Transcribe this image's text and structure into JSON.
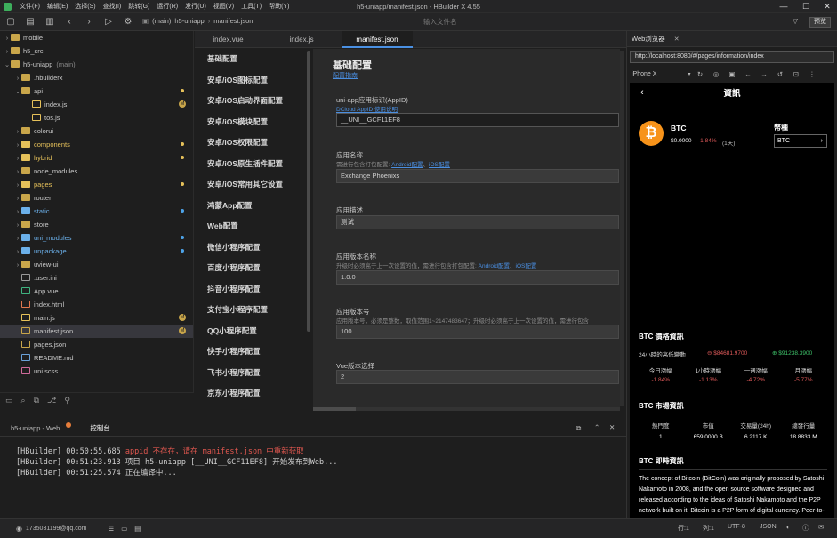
{
  "menu": [
    "文件(F)",
    "编辑(E)",
    "选择(S)",
    "查找(I)",
    "跳转(G)",
    "运行(R)",
    "发行(U)",
    "视图(V)",
    "工具(T)",
    "帮助(Y)"
  ],
  "window_title": "h5-uniapp/manifest.json - HBuilder X 4.55",
  "breadcrumb": [
    "(main)",
    "h5-uniapp",
    "manifest.json"
  ],
  "file_search_placeholder": "输入文件名",
  "preview_button": "预览",
  "tree": [
    {
      "name": "mobile",
      "depth": 0,
      "type": "folder",
      "arrow": "›"
    },
    {
      "name": "h5_src",
      "depth": 0,
      "type": "folder",
      "arrow": "›"
    },
    {
      "name": "h5-uniapp",
      "depth": 0,
      "type": "folder",
      "arrow": "⌄",
      "suffix": "(main)"
    },
    {
      "name": ".hbuilderx",
      "depth": 1,
      "type": "folder",
      "arrow": "›"
    },
    {
      "name": "api",
      "depth": 1,
      "type": "folder",
      "arrow": "⌄",
      "dot": "#e6c15a"
    },
    {
      "name": "index.js",
      "depth": 2,
      "type": "js",
      "badge": "M"
    },
    {
      "name": "tos.js",
      "depth": 2,
      "type": "js"
    },
    {
      "name": "colorui",
      "depth": 1,
      "type": "folder",
      "arrow": "›"
    },
    {
      "name": "components",
      "depth": 1,
      "type": "folder",
      "arrow": "›",
      "dot": "#e6c15a",
      "color": "#e6c15a"
    },
    {
      "name": "hybrid",
      "depth": 1,
      "type": "folder",
      "arrow": "›",
      "dot": "#e6c15a",
      "color": "#e6c15a"
    },
    {
      "name": "node_modules",
      "depth": 1,
      "type": "folder",
      "arrow": "›"
    },
    {
      "name": "pages",
      "depth": 1,
      "type": "folder",
      "arrow": "›",
      "dot": "#e6c15a",
      "color": "#e6c15a"
    },
    {
      "name": "router",
      "depth": 1,
      "type": "folder",
      "arrow": "›"
    },
    {
      "name": "static",
      "depth": 1,
      "type": "folder",
      "arrow": "›",
      "dot": "#4da3e8",
      "color": "#6bb0ea"
    },
    {
      "name": "store",
      "depth": 1,
      "type": "folder",
      "arrow": "›"
    },
    {
      "name": "uni_modules",
      "depth": 1,
      "type": "folder",
      "arrow": "›",
      "dot": "#4da3e8",
      "color": "#6bb0ea"
    },
    {
      "name": "unpackage",
      "depth": 1,
      "type": "folder",
      "arrow": "›",
      "dot": "#4da3e8",
      "color": "#6bb0ea"
    },
    {
      "name": "uview-ui",
      "depth": 1,
      "type": "folder",
      "arrow": "›"
    },
    {
      "name": ".user.ini",
      "depth": 1,
      "type": "file"
    },
    {
      "name": "App.vue",
      "depth": 1,
      "type": "vue"
    },
    {
      "name": "index.html",
      "depth": 1,
      "type": "html"
    },
    {
      "name": "main.js",
      "depth": 1,
      "type": "js",
      "badge": "M"
    },
    {
      "name": "manifest.json",
      "depth": 1,
      "type": "json",
      "badge": "M",
      "selected": true
    },
    {
      "name": "pages.json",
      "depth": 1,
      "type": "json"
    },
    {
      "name": "README.md",
      "depth": 1,
      "type": "md"
    },
    {
      "name": "uni.scss",
      "depth": 1,
      "type": "scss"
    }
  ],
  "editor_tabs": [
    "index.vue",
    "index.js",
    "manifest.json"
  ],
  "config_nav": [
    "基础配置",
    "安卓/iOS图标配置",
    "安卓/iOS启动界面配置",
    "安卓/iOS模块配置",
    "安卓/iOS权限配置",
    "安卓/iOS原生插件配置",
    "安卓/iOS常用其它设置",
    "鸿蒙App配置",
    "Web配置",
    "微信小程序配置",
    "百度小程序配置",
    "抖音小程序配置",
    "支付宝小程序配置",
    "QQ小程序配置",
    "快手小程序配置",
    "飞书小程序配置",
    "京东小程序配置"
  ],
  "config": {
    "title": "基础配置",
    "link": "配置指南",
    "appid_label": "uni-app应用标识(AppID)",
    "appid_link": "DCloud AppID 使用说明",
    "appid_value": "__UNI__GCF11EF8",
    "name_label": "应用名称",
    "name_hint_pre": "需进行包含打包配置:",
    "name_hint_link1": "Android配置",
    "name_hint_link2": "iOS配置",
    "name_value": "Exchange Phoenixs",
    "desc_label": "应用描述",
    "desc_value": "测试",
    "version_label": "应用版本名称",
    "version_hint": "升级时必须高于上一次设置的值，需进行包含打包配置:",
    "version_hint_link1": "Android配置",
    "version_hint_link2": "iOS配置",
    "version_value": "1.0.0",
    "vcode_label": "应用版本号",
    "vcode_hint": "应用版本号，必须是整数，取值范围1~2147483647；升级时必须高于上一次设置的值，需进行包含",
    "vcode_value": "100",
    "vue_label": "Vue版本选择",
    "vue_value": "2"
  },
  "webview": {
    "tab": "Web浏览器",
    "url": "http://localhost:8080/#/pages/information/index",
    "device": "iPhone X",
    "header_title": "資訊",
    "coin_symbol": "₿",
    "coin_name": "BTC",
    "coin_price": "$0.0000",
    "coin_change": "-1.84%",
    "coin_period": "(1天)",
    "currency_label": "幣種",
    "currency_value": "BTC",
    "price_info_title": "BTC 價格資訊",
    "low_high_label": "24小時的高低變動",
    "low_value": "$84681.9700",
    "high_value": "$91238.3900",
    "change_headers": [
      "今日漲幅",
      "1小時漲幅",
      "一週漲幅",
      "月漲幅"
    ],
    "change_values": [
      "-1.84%",
      "-1.13%",
      "-4.72%",
      "-5.77%"
    ],
    "market_title": "BTC 市場資訊",
    "market_headers": [
      "熱門度",
      "市值",
      "交易量(24h)",
      "總發行量"
    ],
    "market_values": [
      "1",
      "659.0000 B",
      "6.2117 K",
      "18.8833 M"
    ],
    "live_title": "BTC 即時資訊",
    "description": "The concept of Bitcoin (BitCoin) was originally proposed by Satoshi Nakamoto in 2008, and the open source software designed and released according to the ideas of Satoshi Nakamoto and the P2P network built on it. Bitcoin is a P2P form of digital currency. Peer-to-peer transmission means a decentralized payment system. Unlike most currencies, Bitcoin is not issued by a specific currency institution. It is generated through a large number of calculations according to a specific algorithm. The Bitcoin economy uses a"
  },
  "bottom_tabs": [
    "h5-uniapp - Web",
    "控制台"
  ],
  "console": [
    {
      "prefix": "[HBuilder] 00:50:55.685 ",
      "text": "appid 不存在，请在 manifest.json 中重新获取",
      "error": true
    },
    {
      "prefix": "[HBuilder] 00:51:23.913 ",
      "text": "项目 h5-uniapp [__UNI__GCF11EF8] 开始发布到Web...",
      "error": false
    },
    {
      "prefix": "[HBuilder] 00:51:25.574 ",
      "text": "正在编译中...",
      "error": false
    }
  ],
  "status": {
    "user": "1735031199@qq.com",
    "row": "行:1",
    "col": "列:1",
    "encoding": "UTF-8",
    "lang": "JSON"
  },
  "colors": {
    "accent": "#4a90e2",
    "bg": "#1e1e1e",
    "panel": "#252526",
    "error": "#e0574f",
    "btc": "#f7931a"
  }
}
